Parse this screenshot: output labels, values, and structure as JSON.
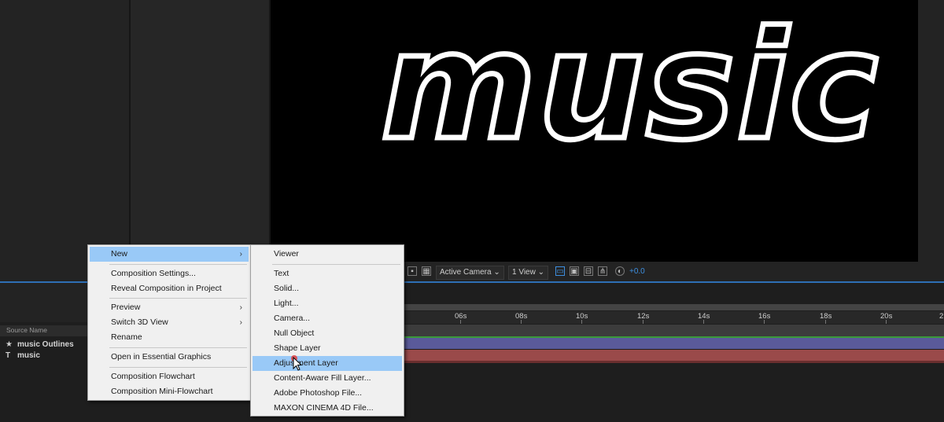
{
  "viewer": {
    "composition_text": "music",
    "toolbar": {
      "camera": "Active Camera",
      "view": "1 View",
      "exposure": "+0.0"
    }
  },
  "timeline": {
    "ticks": [
      "06s",
      "08s",
      "10s",
      "12s",
      "14s",
      "16s",
      "18s",
      "20s",
      "2"
    ],
    "column_header": "Source Name",
    "layers": [
      {
        "icon": "star-icon",
        "glyph": "★",
        "name": "music Outlines",
        "color": "#5a5a9a"
      },
      {
        "icon": "text-layer-icon",
        "glyph": "T",
        "name": "music",
        "color": "#9a4a4a"
      }
    ]
  },
  "context_menu": {
    "items": [
      {
        "label": "New",
        "submenu": true,
        "highlighted": true
      },
      {
        "label": "Composition Settings..."
      },
      {
        "label": "Reveal Composition in Project"
      },
      {
        "label": "Preview",
        "submenu": true
      },
      {
        "label": "Switch 3D View",
        "submenu": true
      },
      {
        "label": "Rename"
      },
      {
        "label": "Open in Essential Graphics"
      },
      {
        "label": "Composition Flowchart"
      },
      {
        "label": "Composition Mini-Flowchart"
      }
    ],
    "arrow": "›"
  },
  "new_submenu": {
    "items": [
      {
        "label": "Viewer"
      },
      {
        "label": "Text"
      },
      {
        "label": "Solid..."
      },
      {
        "label": "Light..."
      },
      {
        "label": "Camera..."
      },
      {
        "label": "Null Object"
      },
      {
        "label": "Shape Layer"
      },
      {
        "label": "Adjustment Layer",
        "highlighted": true
      },
      {
        "label": "Content-Aware Fill Layer..."
      },
      {
        "label": "Adobe Photoshop File..."
      },
      {
        "label": "MAXON CINEMA 4D File..."
      }
    ]
  }
}
